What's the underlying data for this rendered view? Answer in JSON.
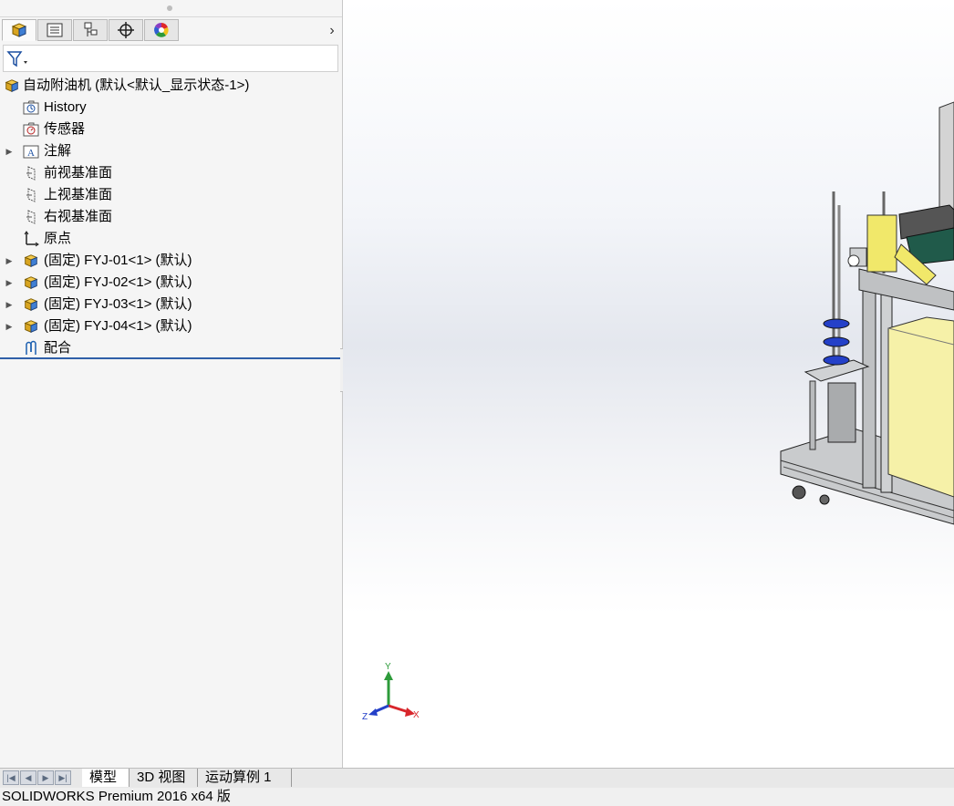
{
  "panel_tabs": [
    {
      "name": "featuremanager-tab",
      "icon": "assembly-icon",
      "active": true
    },
    {
      "name": "propertymanager-tab",
      "icon": "property-list-icon",
      "active": false
    },
    {
      "name": "configurationmanager-tab",
      "icon": "configuration-icon",
      "active": false
    },
    {
      "name": "dimxpert-tab",
      "icon": "crosshair-icon",
      "active": false
    },
    {
      "name": "display-manager-tab",
      "icon": "color-wheel-icon",
      "active": false
    }
  ],
  "tree": {
    "root_label": "自动附油机  (默认<默认_显示状态-1>)",
    "items": [
      {
        "label": "History",
        "icon": "history-folder-icon"
      },
      {
        "label": "传感器",
        "icon": "sensor-folder-icon"
      },
      {
        "label": "注解",
        "icon": "annotation-folder-icon"
      },
      {
        "label": "前视基准面",
        "icon": "plane-icon"
      },
      {
        "label": "上视基准面",
        "icon": "plane-icon"
      },
      {
        "label": "右视基准面",
        "icon": "plane-icon"
      },
      {
        "label": "原点",
        "icon": "origin-icon"
      },
      {
        "label": "(固定) FYJ-01<1> (默认)",
        "icon": "subassembly-icon"
      },
      {
        "label": "(固定) FYJ-02<1> (默认)",
        "icon": "subassembly-icon"
      },
      {
        "label": "(固定) FYJ-03<1> (默认)",
        "icon": "subassembly-icon"
      },
      {
        "label": "(固定) FYJ-04<1> (默认)",
        "icon": "subassembly-icon"
      },
      {
        "label": "配合",
        "icon": "mates-icon"
      }
    ]
  },
  "triad": {
    "x": "X",
    "y": "Y",
    "z": "Z"
  },
  "bottom_tabs": [
    "模型",
    "3D 视图",
    "运动算例 1"
  ],
  "status_text": "SOLIDWORKS Premium 2016 x64 版",
  "colors": {
    "accent_blue": "#2f5fa8",
    "triad_x": "#d8262b",
    "triad_y": "#2d9b3a",
    "triad_z": "#2440c8",
    "model_yellow": "#f6f1a8"
  }
}
